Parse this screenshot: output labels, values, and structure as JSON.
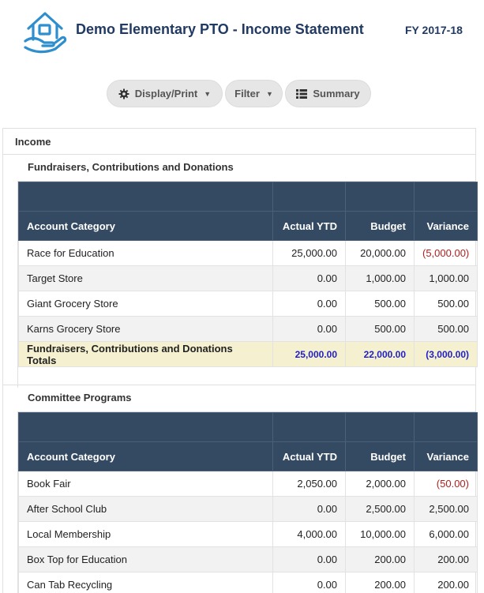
{
  "header": {
    "title": "Demo Elementary PTO - Income Statement",
    "fiscal_year": "FY 2017-18"
  },
  "toolbar": {
    "display_label": "Display/Print",
    "filter_label": "Filter",
    "summary_label": "Summary"
  },
  "income": {
    "label": "Income",
    "columns": [
      "Account Category",
      "Actual YTD",
      "Budget",
      "Variance"
    ],
    "groups": [
      {
        "name": "Fundraisers, Contributions and Donations",
        "rows": [
          {
            "category": "Race for Education",
            "actual": "25,000.00",
            "budget": "20,000.00",
            "variance": "(5,000.00)",
            "negative": true
          },
          {
            "category": "Target Store",
            "actual": "0.00",
            "budget": "1,000.00",
            "variance": "1,000.00",
            "negative": false
          },
          {
            "category": "Giant Grocery Store",
            "actual": "0.00",
            "budget": "500.00",
            "variance": "500.00",
            "negative": false
          },
          {
            "category": "Karns Grocery Store",
            "actual": "0.00",
            "budget": "500.00",
            "variance": "500.00",
            "negative": false
          }
        ],
        "totals": {
          "label": "Fundraisers, Contributions and Donations Totals",
          "actual": "25,000.00",
          "budget": "22,000.00",
          "variance": "(3,000.00)"
        }
      },
      {
        "name": "Committee Programs",
        "rows": [
          {
            "category": "Book Fair",
            "actual": "2,050.00",
            "budget": "2,000.00",
            "variance": "(50.00)",
            "negative": true
          },
          {
            "category": "After School Club",
            "actual": "0.00",
            "budget": "2,500.00",
            "variance": "2,500.00",
            "negative": false
          },
          {
            "category": "Local Membership",
            "actual": "4,000.00",
            "budget": "10,000.00",
            "variance": "6,000.00",
            "negative": false
          },
          {
            "category": "Box Top for Education",
            "actual": "0.00",
            "budget": "200.00",
            "variance": "200.00",
            "negative": false
          },
          {
            "category": "Can Tab Recycling",
            "actual": "0.00",
            "budget": "200.00",
            "variance": "200.00",
            "negative": false
          }
        ]
      }
    ]
  },
  "colors": {
    "title": "#213a63",
    "table_header": "#344a62",
    "negative": "#b02020",
    "totals_bg": "#f5f0cf",
    "totals_values": "#1f1fc8",
    "logo": "#2f8fce"
  },
  "icons": [
    "house-hands-logo",
    "gear-icon",
    "caret-down-icon",
    "list-icon"
  ]
}
